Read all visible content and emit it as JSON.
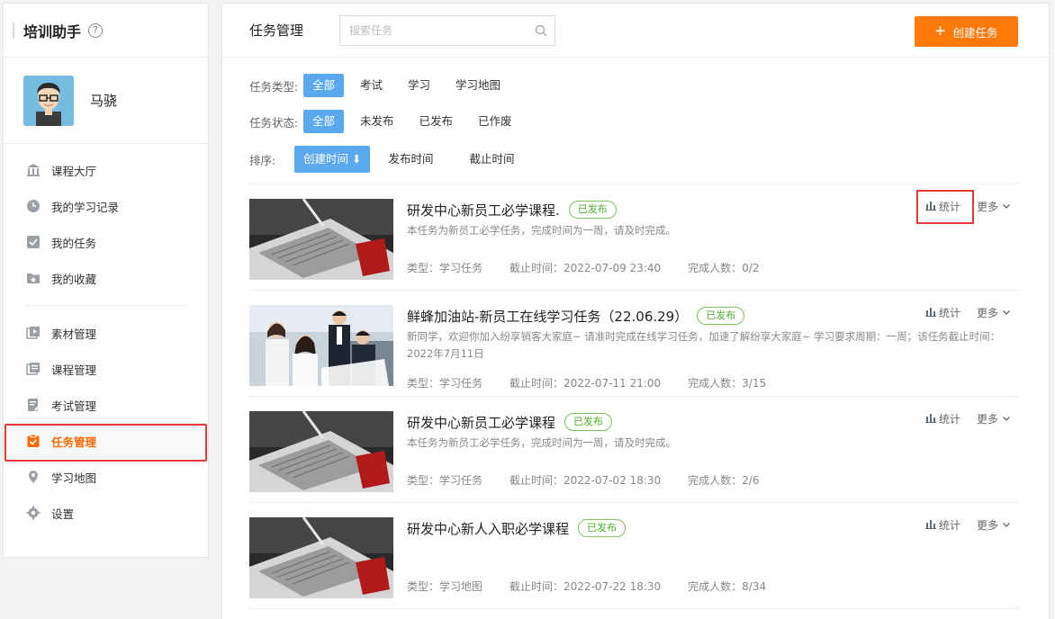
{
  "sidebar": {
    "app_title": "培训助手",
    "help": "?",
    "user": {
      "name": "马骁"
    },
    "menu": [
      {
        "label": "课程大厅",
        "icon": "bank-icon"
      },
      {
        "label": "我的学习记录",
        "icon": "clock-icon"
      },
      {
        "label": "我的任务",
        "icon": "check-square-icon"
      },
      {
        "label": "我的收藏",
        "icon": "star-folder-icon"
      },
      {
        "label": "素材管理",
        "icon": "media-icon"
      },
      {
        "label": "课程管理",
        "icon": "course-icon"
      },
      {
        "label": "考试管理",
        "icon": "exam-icon"
      },
      {
        "label": "任务管理",
        "icon": "task-icon",
        "active": true
      },
      {
        "label": "学习地图",
        "icon": "map-pin-icon"
      },
      {
        "label": "设置",
        "icon": "gear-icon"
      }
    ]
  },
  "header": {
    "title": "任务管理",
    "search_placeholder": "搜索任务",
    "create_label": "创建任务"
  },
  "filters": {
    "type_label": "任务类型:",
    "types": [
      "全部",
      "考试",
      "学习",
      "学习地图"
    ],
    "status_label": "任务状态:",
    "statuses": [
      "全部",
      "未发布",
      "已发布",
      "已作废"
    ],
    "sort_label": "排序:",
    "sorts": [
      "创建时间 ⬇",
      "发布时间",
      "截止时间"
    ]
  },
  "actions": {
    "stat": "统计",
    "more": "更多"
  },
  "tasks": [
    {
      "name": "研发中心新员工必学课程.",
      "status": "已发布",
      "desc": "本任务为新员工必学任务，完成时间为一周，请及时完成。",
      "type": "类型：学习任务",
      "deadline": "截止时间：2022-07-09 23:40",
      "done": "完成人数：0/2",
      "thumb": "laptop"
    },
    {
      "name": "鲜蜂加油站-新员工在线学习任务（22.06.29）",
      "status": "已发布",
      "desc": "新同学，欢迎你加入纷享销客大家庭~ 请准时完成在线学习任务，加速了解纷享大家庭~ 学习要求周期：一周；该任务截止时间：2022年7月11日",
      "type": "类型：学习任务",
      "deadline": "截止时间：2022-07-11 21:00",
      "done": "完成人数：3/15",
      "thumb": "team"
    },
    {
      "name": "研发中心新员工必学课程",
      "status": "已发布",
      "desc": "本任务为新员工必学任务，完成时间为一周，请及时完成。",
      "type": "类型：学习任务",
      "deadline": "截止时间：2022-07-02 18:30",
      "done": "完成人数：2/6",
      "thumb": "laptop"
    },
    {
      "name": "研发中心新人入职必学课程",
      "status": "已发布",
      "desc": "",
      "type": "类型：学习地图",
      "deadline": "截止时间：2022-07-22 18:30",
      "done": "完成人数：8/34",
      "thumb": "laptop"
    }
  ]
}
